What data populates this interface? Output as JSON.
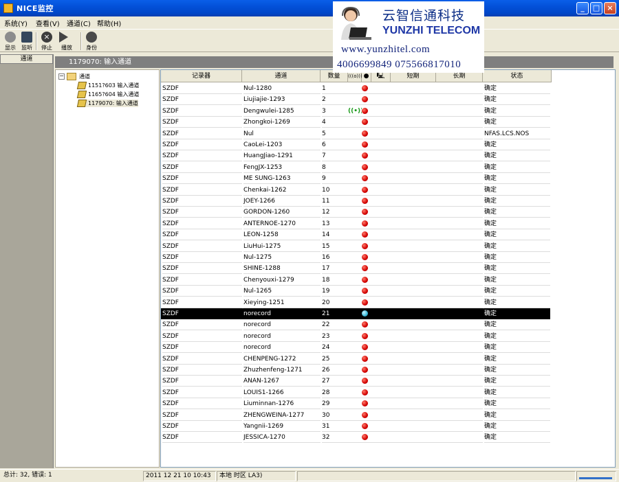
{
  "window": {
    "title": "NICE监控"
  },
  "menu": [
    "系统(Y)",
    "查看(V)",
    "通道(C)",
    "帮助(H)"
  ],
  "toolbar": [
    {
      "label": "显示",
      "icon": "record-icon"
    },
    {
      "label": "监听",
      "icon": "monitor-icon"
    },
    {
      "label": "停止",
      "icon": "stop-icon"
    },
    {
      "label": "播放",
      "icon": "play-icon"
    },
    {
      "label": "身份",
      "icon": "users-icon"
    }
  ],
  "left_panel": {
    "header": "通道"
  },
  "path_bar": "1179070: 输入通道",
  "tree": {
    "root": "通道",
    "children": [
      "1151?603 输入通道",
      "1165?604 输入通道",
      "1179070: 输入通道"
    ]
  },
  "table": {
    "columns": [
      "记录器",
      "通道",
      "数量",
      "(((o)))",
      "●",
      "🖳",
      "短期",
      "长期",
      "状态"
    ],
    "rows": [
      {
        "recorder": "SZDF",
        "channel": "Nul-1280",
        "num": "1",
        "status": "确定"
      },
      {
        "recorder": "SZDF",
        "channel": "Liujiajie-1293",
        "num": "2",
        "status": "确定"
      },
      {
        "recorder": "SZDF",
        "channel": "Dengwulei-1285",
        "num": "3",
        "status": "确定",
        "signal": true
      },
      {
        "recorder": "SZDF",
        "channel": "Zhongkoi-1269",
        "num": "4",
        "status": "确定"
      },
      {
        "recorder": "SZDF",
        "channel": "Nul",
        "num": "5",
        "status": "NFAS.LCS.NOS"
      },
      {
        "recorder": "SZDF",
        "channel": "CaoLei-1203",
        "num": "6",
        "status": "确定"
      },
      {
        "recorder": "SZDF",
        "channel": "HuangJiao-1291",
        "num": "7",
        "status": "确定"
      },
      {
        "recorder": "SZDF",
        "channel": "FengJX-1253",
        "num": "8",
        "status": "确定"
      },
      {
        "recorder": "SZDF",
        "channel": "ME SUNG-1263",
        "num": "9",
        "status": "确定"
      },
      {
        "recorder": "SZDF",
        "channel": "Chenkai-1262",
        "num": "10",
        "status": "确定"
      },
      {
        "recorder": "SZDF",
        "channel": "JOEY-1266",
        "num": "11",
        "status": "确定"
      },
      {
        "recorder": "SZDF",
        "channel": "GORDON-1260",
        "num": "12",
        "status": "确定"
      },
      {
        "recorder": "SZDF",
        "channel": "ANTERNOE-1270",
        "num": "13",
        "status": "确定"
      },
      {
        "recorder": "SZDF",
        "channel": "LEON-1258",
        "num": "14",
        "status": "确定"
      },
      {
        "recorder": "SZDF",
        "channel": "LiuHui-1275",
        "num": "15",
        "status": "确定"
      },
      {
        "recorder": "SZDF",
        "channel": "Nul-1275",
        "num": "16",
        "status": "确定"
      },
      {
        "recorder": "SZDF",
        "channel": "SHINE-1288",
        "num": "17",
        "status": "确定"
      },
      {
        "recorder": "SZDF",
        "channel": "Chenyouxi-1279",
        "num": "18",
        "status": "确定"
      },
      {
        "recorder": "SZDF",
        "channel": "Nul-1265",
        "num": "19",
        "status": "确定"
      },
      {
        "recorder": "SZDF",
        "channel": "Xieying-1251",
        "num": "20",
        "status": "确定"
      },
      {
        "recorder": "SZDF",
        "channel": "norecord",
        "num": "21",
        "status": "确定",
        "selected": true
      },
      {
        "recorder": "SZDF",
        "channel": "norecord",
        "num": "22",
        "status": "确定"
      },
      {
        "recorder": "SZDF",
        "channel": "norecord",
        "num": "23",
        "status": "确定"
      },
      {
        "recorder": "SZDF",
        "channel": "norecord",
        "num": "24",
        "status": "确定"
      },
      {
        "recorder": "SZDF",
        "channel": "CHENPENG-1272",
        "num": "25",
        "status": "确定"
      },
      {
        "recorder": "SZDF",
        "channel": "Zhuzhenfeng-1271",
        "num": "26",
        "status": "确定"
      },
      {
        "recorder": "SZDF",
        "channel": "ANAN-1267",
        "num": "27",
        "status": "确定"
      },
      {
        "recorder": "SZDF",
        "channel": "LOUIS1-1266",
        "num": "28",
        "status": "确定"
      },
      {
        "recorder": "SZDF",
        "channel": "Liuminnan-1276",
        "num": "29",
        "status": "确定"
      },
      {
        "recorder": "SZDF",
        "channel": "ZHENGWEINA-1277",
        "num": "30",
        "status": "确定"
      },
      {
        "recorder": "SZDF",
        "channel": "Yangnii-1269",
        "num": "31",
        "status": "确定"
      },
      {
        "recorder": "SZDF",
        "channel": "JESSICA-1270",
        "num": "32",
        "status": "确定"
      }
    ]
  },
  "status_bar": {
    "total": "总计: 32,",
    "errors": "错误: 1",
    "datetime": "2011 12 21 10 10:43",
    "local_time": "本地 时区 LA3)"
  },
  "watermark": {
    "company_cn": "云智信通科技",
    "company_en": "YUNZHI TELECOM",
    "url": "www.yunzhitel.com",
    "phone": "4006699849  075566817010"
  }
}
